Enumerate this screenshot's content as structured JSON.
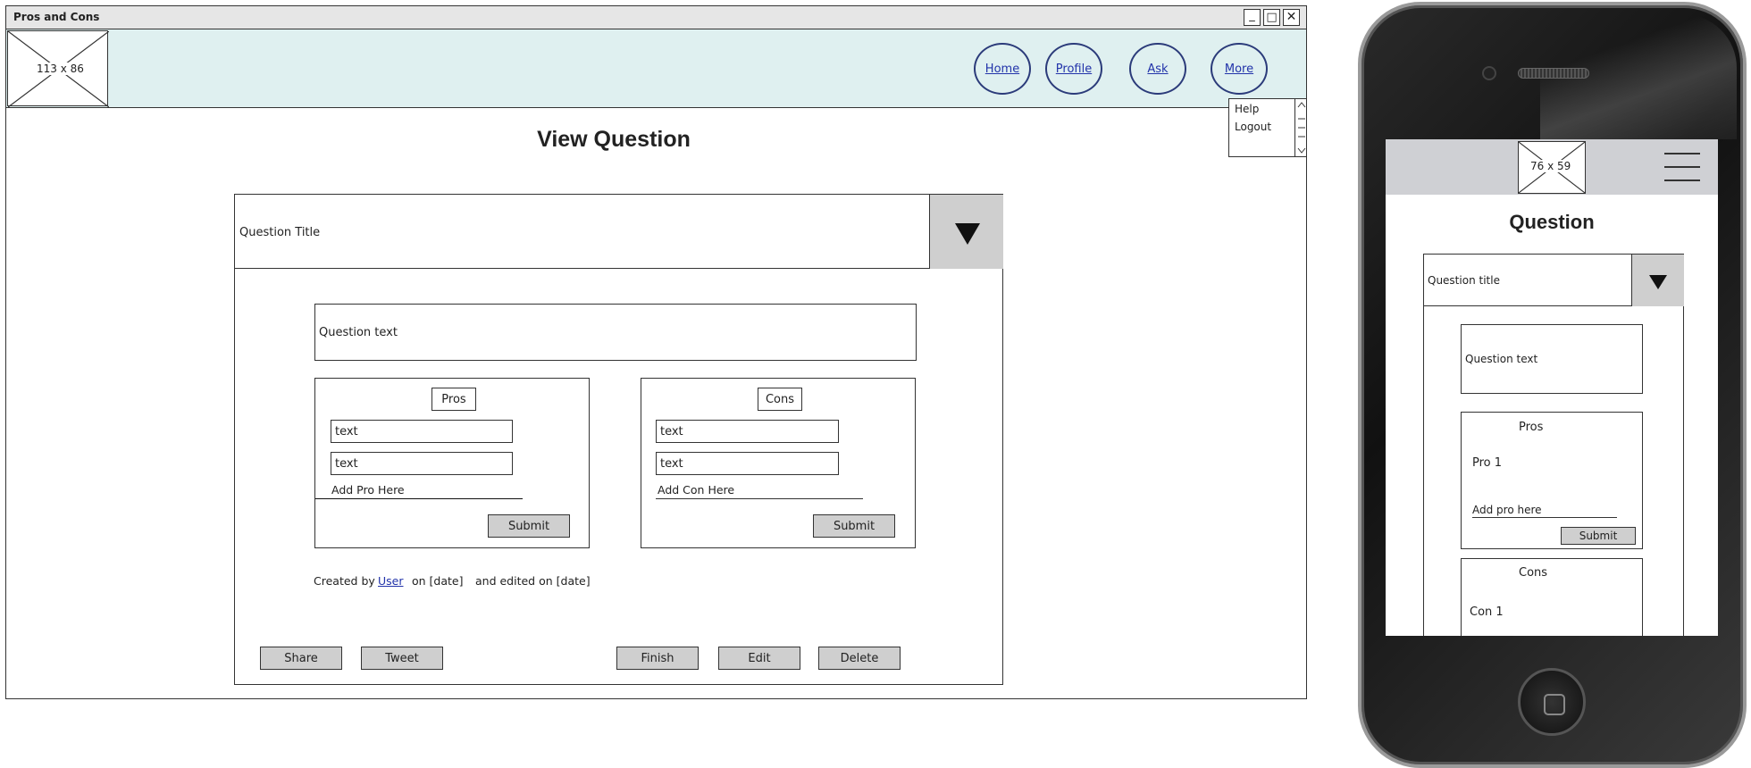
{
  "window": {
    "title": "Pros and Cons",
    "controls": {
      "minimize": "_",
      "maximize": "□",
      "close": "✕"
    }
  },
  "header": {
    "logo_placeholder": "113 x 86",
    "nav": [
      {
        "label": "Home"
      },
      {
        "label": "Profile"
      },
      {
        "label": "Ask"
      },
      {
        "label": "More"
      }
    ],
    "more_menu": [
      "Help",
      "Logout"
    ]
  },
  "page": {
    "heading": "View Question",
    "question_title": "Question Title",
    "question_text": "Question text",
    "pros": {
      "heading": "Pros",
      "items": [
        "text",
        "text"
      ],
      "add_placeholder": "Add Pro Here",
      "submit": "Submit"
    },
    "cons": {
      "heading": "Cons",
      "items": [
        "text",
        "text"
      ],
      "add_placeholder": "Add Con Here",
      "submit": "Submit"
    },
    "meta": {
      "created_by": "Created by",
      "user": "User",
      "on_date": "on [date]",
      "edited": "and edited on [date]"
    },
    "actions": {
      "share": "Share",
      "tweet": "Tweet",
      "finish": "Finish",
      "edit": "Edit",
      "delete": "Delete"
    }
  },
  "mobile": {
    "logo_placeholder": "76 x 59",
    "heading": "Question",
    "question_title": "Question title",
    "question_text": "Question text",
    "pros_heading": "Pros",
    "pro_item": "Pro 1",
    "add_pro": "Add pro here",
    "submit": "Submit",
    "cons_heading": "Cons",
    "con_item": "Con 1"
  },
  "colors": {
    "header_bg": "#dff0f0",
    "button_bg": "#cfcfcf",
    "link": "#2233aa",
    "nav_border": "#2b3b7a"
  }
}
